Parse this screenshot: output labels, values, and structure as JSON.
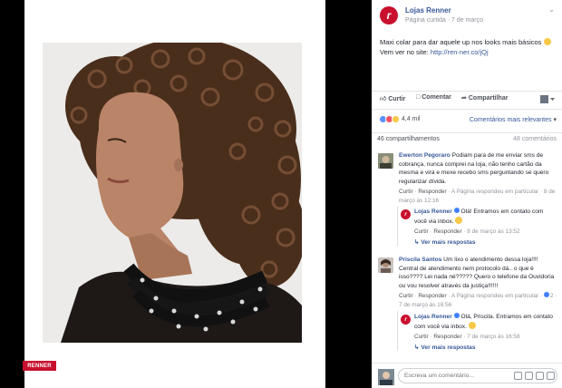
{
  "page": {
    "name": "Lojas Renner",
    "logo_letter": "r",
    "meta": "Página curtida · 7 de março",
    "brand_color": "#c8102e",
    "link_color": "#365899"
  },
  "photo": {
    "tag": "RENNER"
  },
  "post": {
    "caption": "Maxi colar para dar aquele up nos looks mais básicos",
    "caption_cta": "Vem ver no site:",
    "url": "http://ren-ner.co/jQj"
  },
  "actions": {
    "like": "Curtir",
    "comment": "Comentar",
    "share": "Compartilhar"
  },
  "reactions": {
    "count": "4,4 mil",
    "sort": "Comentários mais relevantes"
  },
  "stats": {
    "shares": "46 compartilhamentos",
    "comments": "48 comentários"
  },
  "comments": [
    {
      "author": "Ewerton Pegoraro",
      "text": "Podiam para de me enviar sms de cobrança, nunca comprei na loja, não tenho cartão da mesma e vira e mexe recebo sms perguntando se quero regularizar dívida.",
      "actions": [
        "Curtir",
        "Responder"
      ],
      "page_replied": "A Página respondeu em particular",
      "time": "8 de março às 12:16",
      "reply": {
        "author": "Lojas Renner",
        "text": "Olá! Entramos em contato com você via inbox.",
        "actions": [
          "Curtir",
          "Responder"
        ],
        "time": "8 de março às 13:52"
      },
      "more_replies": "Ver mais respostas"
    },
    {
      "author": "Priscila Santos",
      "text": "Um lixo o atendimento dessa loja!!!! Central de atendimento nem protocolo dá.. o que é isso???? Lei nada né????? Quero o telefone da Ouvidoria ou vou resolver através da justiça!!!!!!",
      "actions": [
        "Curtir",
        "Responder"
      ],
      "page_replied": "A Página respondeu em particular",
      "reactions": "2",
      "time": "7 de março às 16:56",
      "reply": {
        "author": "Lojas Renner",
        "text": "Olá, Priscila. Entramos em contato com você via inbox.",
        "actions": [
          "Curtir",
          "Responder"
        ],
        "time": "7 de março às 16:58"
      },
      "more_replies": "Ver mais respostas"
    }
  ],
  "compose": {
    "placeholder": "Escreva um comentário..."
  }
}
